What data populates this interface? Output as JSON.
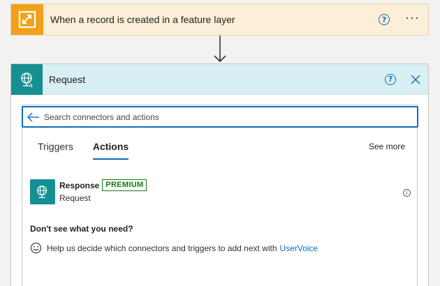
{
  "trigger": {
    "title": "When a record is created in a feature layer",
    "help_glyph": "?",
    "more_glyph": "···",
    "icon": "arcgis-connector-icon",
    "color": "#f3a01b"
  },
  "request": {
    "title": "Request",
    "help_glyph": "?",
    "icon": "globe-request-icon",
    "color": "#168f93"
  },
  "search": {
    "placeholder": "Search connectors and actions"
  },
  "tabs": [
    {
      "label": "Triggers",
      "active": false
    },
    {
      "label": "Actions",
      "active": true
    }
  ],
  "see_more": "See more",
  "actions": [
    {
      "name": "Response",
      "badge": "PREMIUM",
      "subtitle": "Request",
      "info_glyph": "i"
    }
  ],
  "footer": {
    "question": "Don't see what you need?",
    "help_text": "Help us decide which connectors and triggers to add next with",
    "link_text": "UserVoice"
  },
  "colors": {
    "accent": "#0f6cbd",
    "premium": "#107c10"
  }
}
